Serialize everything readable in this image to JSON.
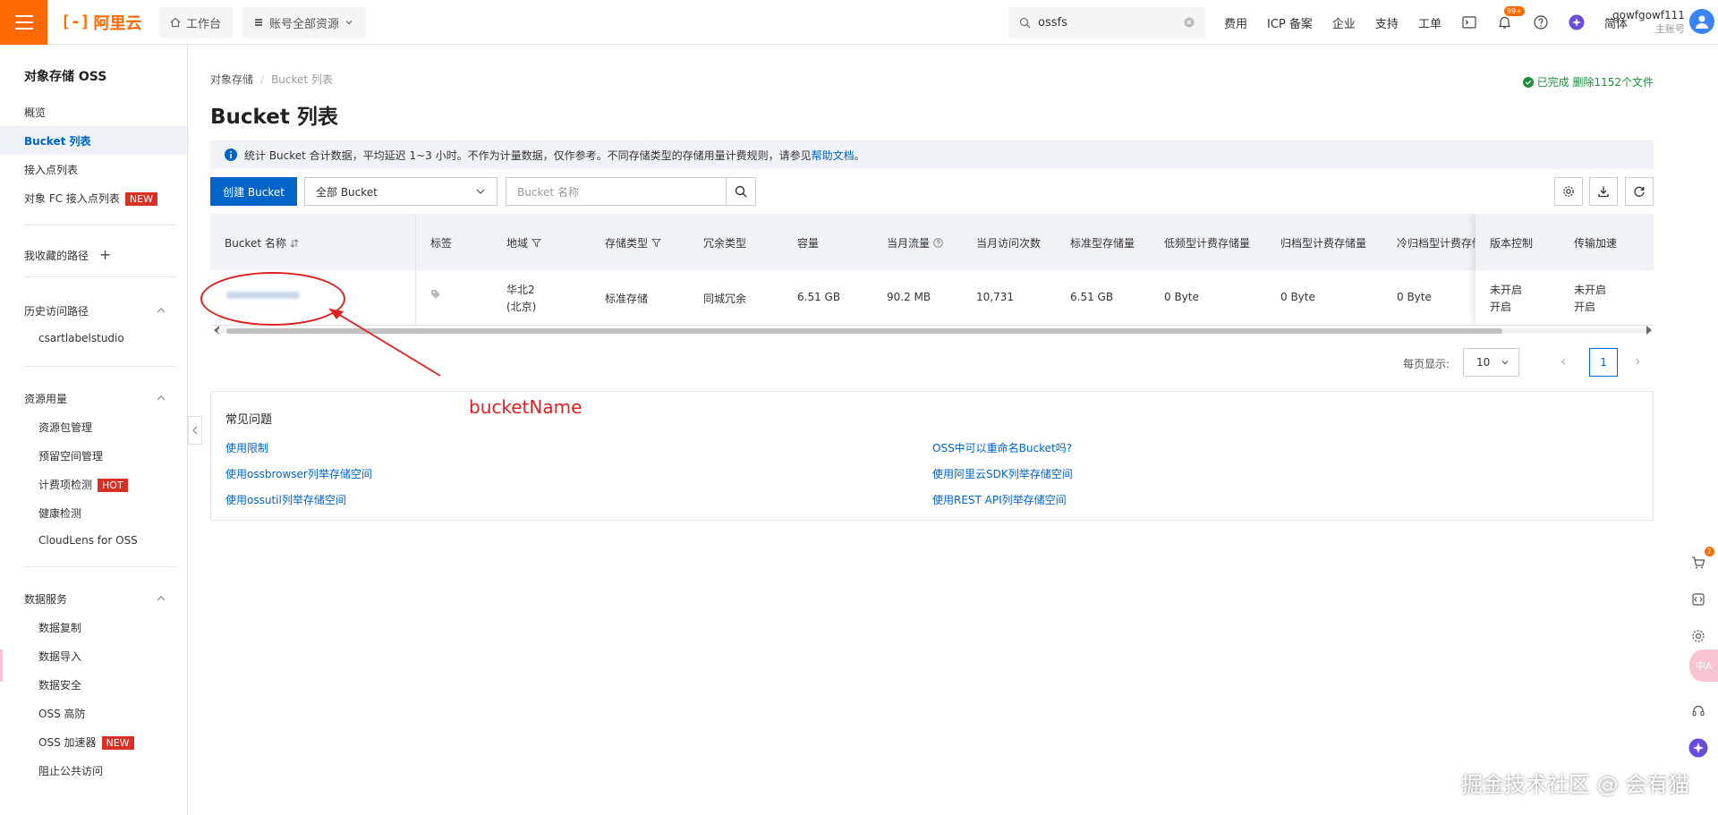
{
  "header": {
    "logo_text": "阿里云",
    "workbench": "工作台",
    "resources": "账号全部资源",
    "search_value": "ossfs",
    "links": [
      "费用",
      "ICP 备案",
      "企业",
      "支持",
      "工单"
    ],
    "notification_badge": "99+",
    "language": "简体",
    "user_name": "gowfgowf111",
    "user_role": "主账号"
  },
  "sidebar": {
    "title": "对象存储 OSS",
    "items": [
      {
        "label": "概览"
      },
      {
        "label": "Bucket 列表"
      },
      {
        "label": "接入点列表"
      },
      {
        "label": "对象 FC 接入点列表",
        "tag": "NEW"
      }
    ],
    "favorites": "我收藏的路径",
    "history": {
      "label": "历史访问路径",
      "items": [
        "csartlabelstudio"
      ]
    },
    "resource_usage": {
      "label": "资源用量",
      "items": [
        {
          "label": "资源包管理"
        },
        {
          "label": "预留空间管理"
        },
        {
          "label": "计费项检测",
          "tag": "HOT"
        },
        {
          "label": "健康检测"
        },
        {
          "label": "CloudLens for OSS"
        }
      ]
    },
    "data_service": {
      "label": "数据服务",
      "items": [
        {
          "label": "数据复制"
        },
        {
          "label": "数据导入"
        },
        {
          "label": "数据安全"
        },
        {
          "label": "OSS 高防"
        },
        {
          "label": "OSS 加速器",
          "tag": "NEW"
        },
        {
          "label": "阻止公共访问"
        }
      ]
    }
  },
  "main": {
    "breadcrumb": [
      "对象存储",
      "Bucket 列表"
    ],
    "title": "Bucket 列表",
    "status": "已完成 删除1152个文件",
    "info_text": "统计 Bucket 合计数据，平均延迟 1~3 小时。不作为计量数据，仅作参考。不同存储类型的存储用量计费规则，请参见",
    "info_link": "帮助文档",
    "info_end": "。",
    "create_button": "创建 Bucket",
    "filter_select": "全部 Bucket",
    "search_placeholder": "Bucket 名称"
  },
  "table": {
    "headers": [
      "Bucket 名称",
      "标签",
      "地域",
      "存储类型",
      "冗余类型",
      "容量",
      "当月流量",
      "当月访问次数",
      "标准型存储量",
      "低频型计费存储量",
      "归档型计费存储量",
      "冷归档型计费存储",
      "版本控制",
      "传输加速"
    ],
    "row": {
      "region": "华北2",
      "region_city": "(北京)",
      "storage_type": "标准存储",
      "redundancy": "同城冗余",
      "capacity": "6.51 GB",
      "traffic": "90.2 MB",
      "visits": "10,731",
      "standard": "6.51 GB",
      "ia": "0 Byte",
      "archive": "0 Byte",
      "cold_archive": "0 Byte",
      "versioning": "未开启",
      "versioning_action": "开启",
      "acceleration": "未开启",
      "acceleration_action": "开启"
    }
  },
  "pagination": {
    "per_page_label": "每页显示:",
    "per_page": "10",
    "current": "1"
  },
  "faq": {
    "title": "常见问题",
    "left": [
      "使用限制",
      "使用ossbrowser列举存储空间",
      "使用ossutil列举存储空间"
    ],
    "right": [
      "OSS中可以重命名Bucket吗?",
      "使用阿里云SDK列举存储空间",
      "使用REST API列举存储空间"
    ]
  },
  "annotation": {
    "label": "bucketName"
  },
  "right_float": {
    "cart_badge": "2",
    "pink_text": "中A"
  },
  "watermark": "掘金技术社区 @ 会有猫"
}
